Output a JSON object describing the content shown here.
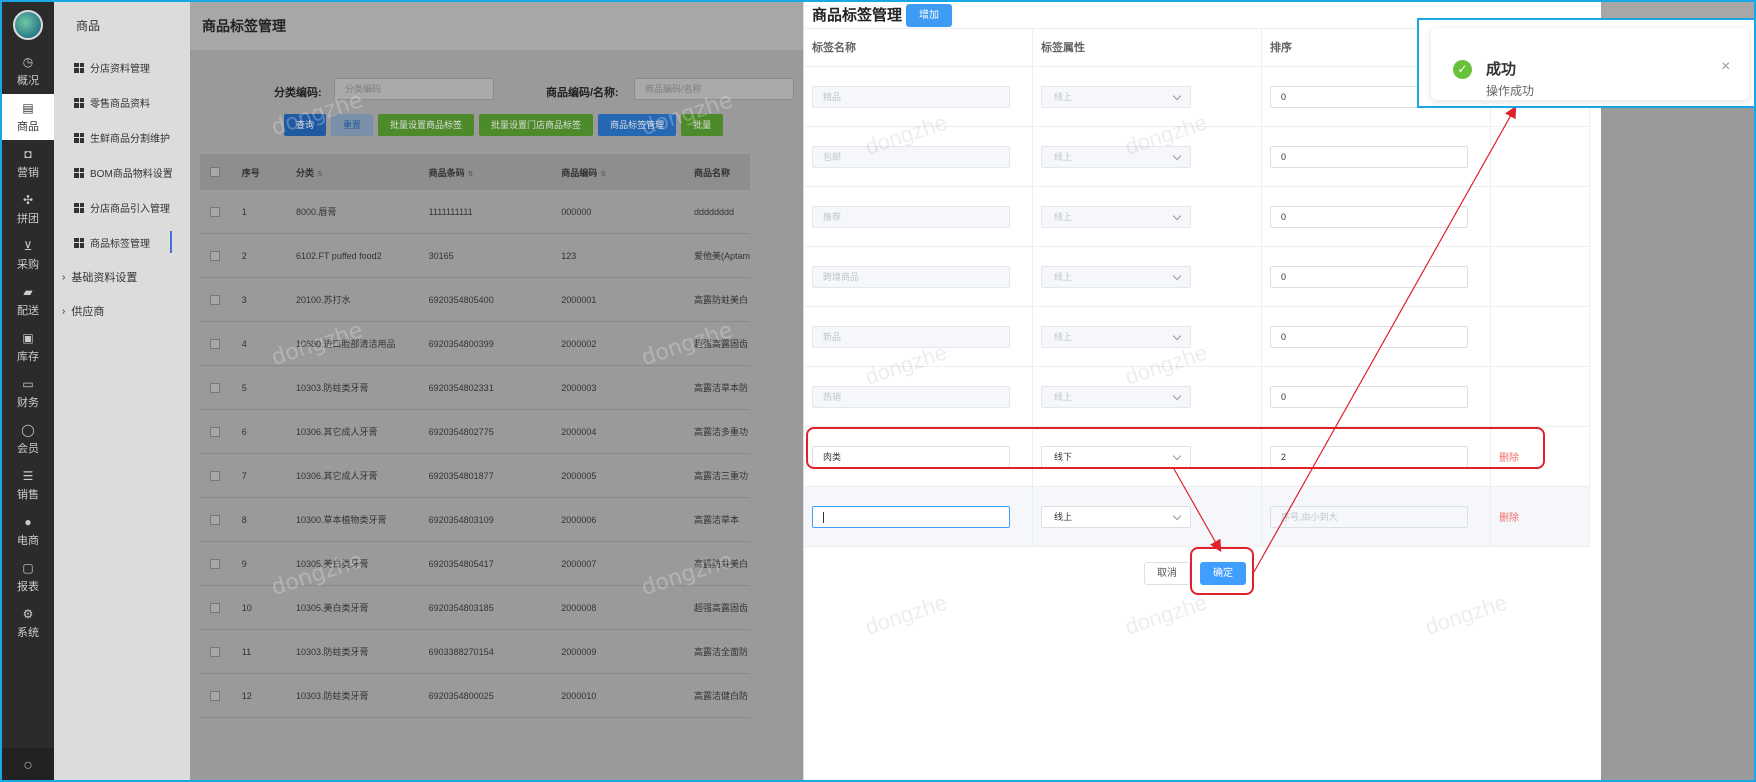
{
  "sidebar": {
    "items": [
      {
        "label": "概况",
        "icon": "dashboard-icon"
      },
      {
        "label": "商品",
        "icon": "document-icon"
      },
      {
        "label": "营销",
        "icon": "bag-icon"
      },
      {
        "label": "拼团",
        "icon": "grid-icon"
      },
      {
        "label": "采购",
        "icon": "cart-icon"
      },
      {
        "label": "配送",
        "icon": "truck-icon"
      },
      {
        "label": "库存",
        "icon": "box-icon"
      },
      {
        "label": "财务",
        "icon": "wallet-icon"
      },
      {
        "label": "会员",
        "icon": "user-icon"
      },
      {
        "label": "销售",
        "icon": "layers-icon"
      },
      {
        "label": "电商",
        "icon": "person-icon"
      },
      {
        "label": "报表",
        "icon": "report-icon"
      },
      {
        "label": "系统",
        "icon": "gear-icon"
      }
    ]
  },
  "submenu": {
    "header": "商品",
    "items": [
      "分店资料管理",
      "零售商品资料",
      "生鲜商品分割维护",
      "BOM商品物料设置",
      "分店商品引入管理",
      "商品标签管理"
    ],
    "groups": [
      "基础资料设置",
      "供应商"
    ]
  },
  "main": {
    "title": "商品标签管理",
    "filters": {
      "category_label": "分类编码:",
      "category_placeholder": "分类编码",
      "product_label": "商品编码/名称:",
      "product_placeholder": "商品编码/名称"
    },
    "buttons": [
      "查询",
      "重置",
      "批量设置商品标签",
      "批量设置门店商品标签",
      "商品标签管理",
      "批量"
    ],
    "table": {
      "headers": [
        "序号",
        "分类",
        "商品条码",
        "商品编码",
        "商品名称"
      ],
      "rows": [
        [
          "1",
          "8000.唇膏",
          "1111111111",
          "000000",
          "dddddddd"
        ],
        [
          "2",
          "6102.FT puffed food2",
          "30165",
          "123",
          "爱他美(Aptam"
        ],
        [
          "3",
          "20100.苏打水",
          "6920354805400",
          "2000001",
          "高露防蛀美白"
        ],
        [
          "4",
          "10680.进口脸部清洁用品",
          "6920354800399",
          "2000002",
          "超强高露固齿"
        ],
        [
          "5",
          "10303.防蛀类牙膏",
          "6920354802331",
          "2000003",
          "高露洁草本防"
        ],
        [
          "6",
          "10306.其它成人牙膏",
          "6920354802775",
          "2000004",
          "高露洁多重功"
        ],
        [
          "7",
          "10306.其它成人牙膏",
          "6920354801877",
          "2000005",
          "高露洁三重功"
        ],
        [
          "8",
          "10300.草本植物类牙膏",
          "6920354803109",
          "2000006",
          "高露洁草本"
        ],
        [
          "9",
          "10305.美白类牙膏",
          "6920354805417",
          "2000007",
          "高露防蛀美白"
        ],
        [
          "10",
          "10305.美白类牙膏",
          "6920354803185",
          "2000008",
          "超强高露固齿"
        ],
        [
          "11",
          "10303.防蛀类牙膏",
          "6903388270154",
          "2000009",
          "高露洁全面防"
        ],
        [
          "12",
          "10303.防蛀类牙膏",
          "6920354800025",
          "2000010",
          "高露洁健白防"
        ]
      ]
    },
    "watermark": "dongzhe"
  },
  "drawer": {
    "title": "商品标签管理",
    "add_label": "增加",
    "headers": [
      "标签名称",
      "标签属性",
      "排序"
    ],
    "rows": [
      {
        "name": "精品",
        "attr": "线上",
        "order": "0",
        "disabled": true
      },
      {
        "name": "包邮",
        "attr": "线上",
        "order": "0",
        "disabled": true
      },
      {
        "name": "推荐",
        "attr": "线上",
        "order": "0",
        "disabled": true
      },
      {
        "name": "跨境商品",
        "attr": "线上",
        "order": "0",
        "disabled": true
      },
      {
        "name": "新品",
        "attr": "线上",
        "order": "0",
        "disabled": true
      },
      {
        "name": "热销",
        "attr": "线上",
        "order": "0",
        "disabled": true
      },
      {
        "name": "肉类",
        "attr": "线下",
        "order": "2",
        "disabled": false,
        "delete": "删除"
      },
      {
        "name": "",
        "attr": "线上",
        "order": "",
        "order_placeholder": "序号,由小到大",
        "disabled": false,
        "delete": "删除"
      }
    ],
    "cancel": "取消",
    "confirm": "确定"
  },
  "toast": {
    "title": "成功",
    "message": "操作成功"
  },
  "colors": {
    "accent": "#409eff",
    "success": "#67c23a",
    "danger": "#f56c6c",
    "annotation": "#e0202a",
    "frame": "#1aa7e6"
  }
}
